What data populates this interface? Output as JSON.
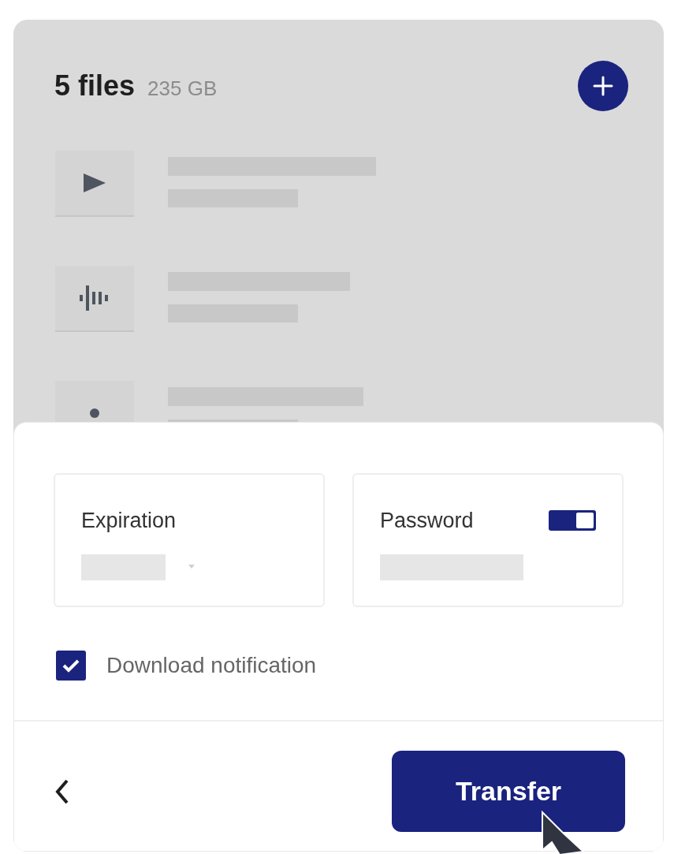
{
  "header": {
    "title": "5 files",
    "size": "235 GB"
  },
  "files": [
    {
      "kind": "video"
    },
    {
      "kind": "audio"
    },
    {
      "kind": "image"
    }
  ],
  "settings": {
    "expiration": {
      "label": "Expiration"
    },
    "password": {
      "label": "Password",
      "on": true
    }
  },
  "notification": {
    "label": "Download notification",
    "checked": true
  },
  "footer": {
    "primary": "Transfer"
  }
}
